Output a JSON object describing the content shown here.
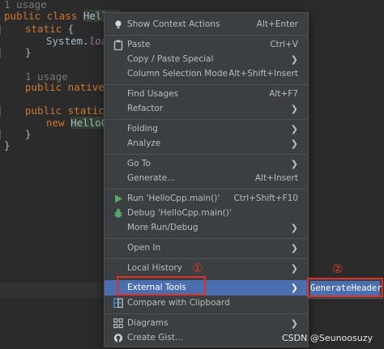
{
  "editor": {
    "lines": [
      {
        "id": "usage1",
        "text": "1 usage"
      },
      {
        "kw1": "public class ",
        "name": "HelloC"
      },
      {
        "kw": "static",
        "rest": " {"
      },
      {
        "pre": "System.",
        "method": "loac"
      },
      {
        "text": "}"
      },
      {
        "id": "usage2",
        "text": "1 usage"
      },
      {
        "kw": "public native ",
        "rest": "v"
      },
      {
        "kw": "public static ",
        "rest": "v"
      },
      {
        "kw": "new ",
        "name": "HelloCpp"
      },
      {
        "text": "}"
      },
      {
        "text": "}"
      }
    ]
  },
  "menu": {
    "items": [
      {
        "key": "show_context_actions",
        "label": "Show Context Actions",
        "shortcut": "Alt+Enter",
        "icon": "bulb-icon"
      },
      {
        "key": "paste",
        "label": "Paste",
        "shortcut": "Ctrl+V",
        "icon": "clipboard-icon"
      },
      {
        "key": "copy_paste_special",
        "label": "Copy / Paste Special",
        "submenu": true
      },
      {
        "key": "column_selection_mode",
        "label": "Column Selection Mode",
        "shortcut": "Alt+Shift+Insert"
      },
      {
        "key": "find_usages",
        "label": "Find Usages",
        "shortcut": "Alt+F7"
      },
      {
        "key": "refactor",
        "label": "Refactor",
        "submenu": true
      },
      {
        "key": "folding",
        "label": "Folding",
        "submenu": true
      },
      {
        "key": "analyze",
        "label": "Analyze",
        "submenu": true
      },
      {
        "key": "go_to",
        "label": "Go To",
        "submenu": true
      },
      {
        "key": "generate",
        "label": "Generate...",
        "shortcut": "Alt+Insert"
      },
      {
        "key": "run",
        "label": "Run 'HelloCpp.main()'",
        "shortcut": "Ctrl+Shift+F10",
        "icon": "run-icon"
      },
      {
        "key": "debug",
        "label": "Debug 'HelloCpp.main()'",
        "icon": "debug-icon"
      },
      {
        "key": "more_run_debug",
        "label": "More Run/Debug",
        "submenu": true
      },
      {
        "key": "open_in",
        "label": "Open In",
        "submenu": true
      },
      {
        "key": "local_history",
        "label": "Local History",
        "submenu": true
      },
      {
        "key": "external_tools",
        "label": "External Tools",
        "submenu": true,
        "selected": true
      },
      {
        "key": "compare_clipboard",
        "label": "Compare with Clipboard",
        "icon": "compare-icon"
      },
      {
        "key": "diagrams",
        "label": "Diagrams",
        "submenu": true,
        "icon": "diagram-icon"
      },
      {
        "key": "create_gist",
        "label": "Create Gist...",
        "icon": "github-icon"
      }
    ]
  },
  "submenu": {
    "item": "GenerateHeader"
  },
  "annotations": {
    "one": "①",
    "two": "②"
  },
  "watermark": "CSDN @Seunoosuzy",
  "colors": {
    "selection": "#4b6eaf",
    "annotation_red": "#e0302a",
    "menu_bg": "#3c3f41",
    "editor_bg": "#2b2b2b"
  }
}
